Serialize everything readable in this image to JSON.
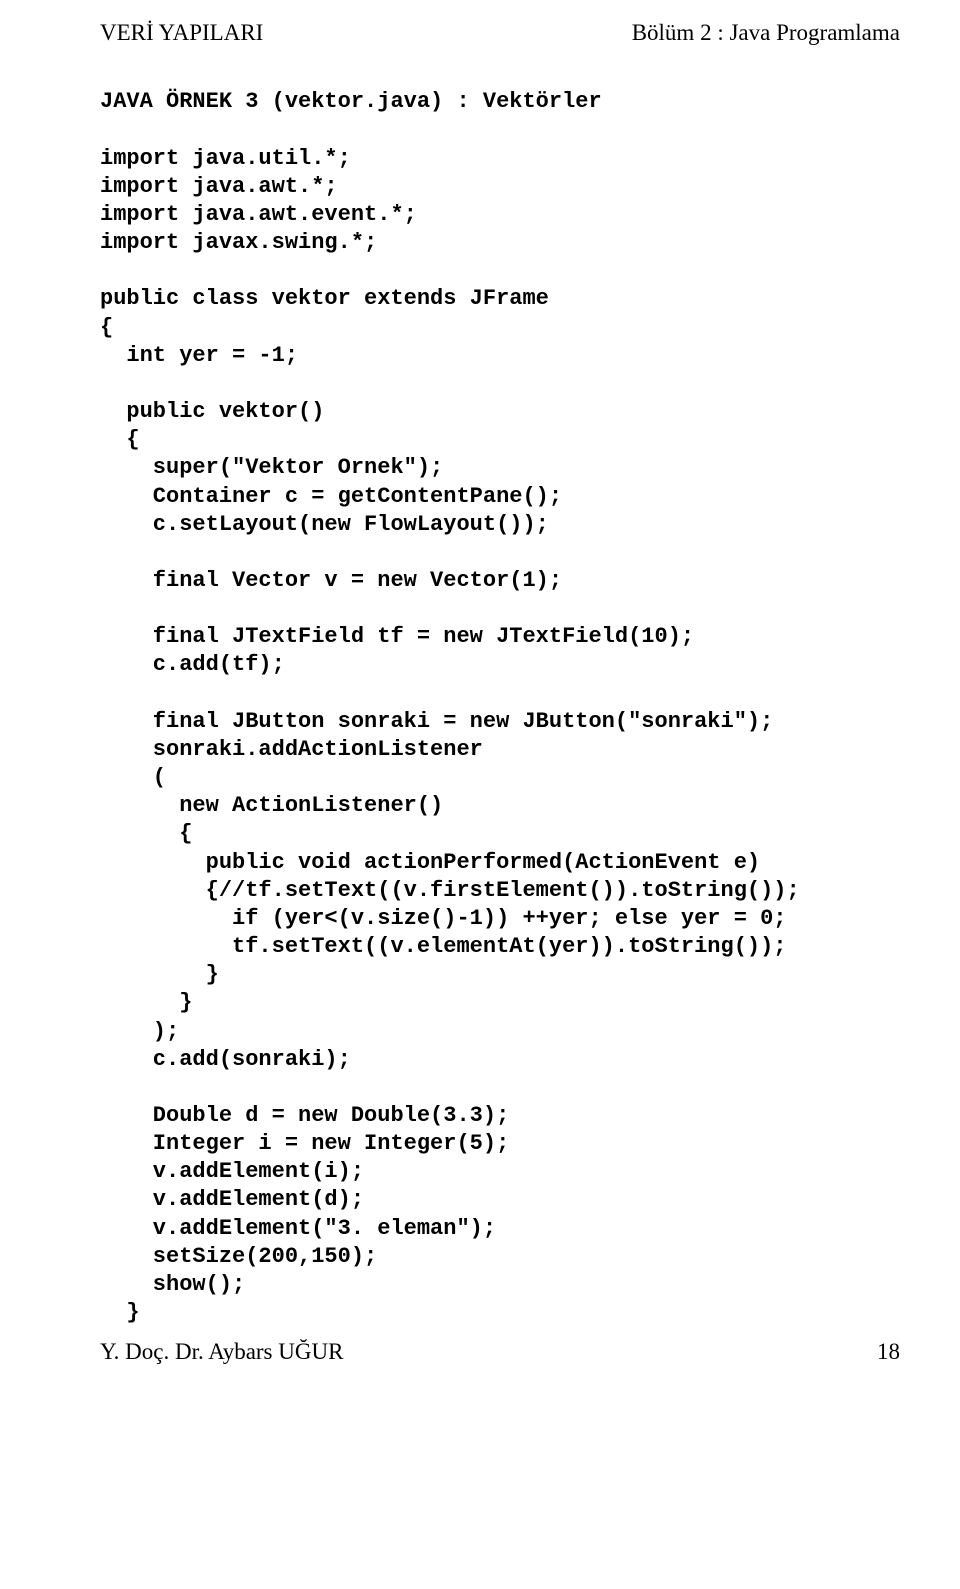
{
  "header": {
    "left": "VERİ YAPILARI",
    "right": "Bölüm 2 : Java Programlama"
  },
  "code": "JAVA ÖRNEK 3 (vektor.java) : Vektörler\n\nimport java.util.*;\nimport java.awt.*;\nimport java.awt.event.*;\nimport javax.swing.*;\n\npublic class vektor extends JFrame\n{\n  int yer = -1;\n\n  public vektor()\n  {\n    super(\"Vektor Ornek\");\n    Container c = getContentPane();\n    c.setLayout(new FlowLayout());\n\n    final Vector v = new Vector(1);\n\n    final JTextField tf = new JTextField(10);\n    c.add(tf);\n\n    final JButton sonraki = new JButton(\"sonraki\");\n    sonraki.addActionListener\n    (\n      new ActionListener()\n      {\n        public void actionPerformed(ActionEvent e)\n        {//tf.setText((v.firstElement()).toString());\n          if (yer<(v.size()-1)) ++yer; else yer = 0;\n          tf.setText((v.elementAt(yer)).toString());\n        }\n      }\n    );\n    c.add(sonraki);\n\n    Double d = new Double(3.3);\n    Integer i = new Integer(5);\n    v.addElement(i);\n    v.addElement(d);\n    v.addElement(\"3. eleman\");\n    setSize(200,150);\n    show();\n  }",
  "footer": {
    "left": "Y. Doç. Dr. Aybars UĞUR",
    "right": "18"
  }
}
